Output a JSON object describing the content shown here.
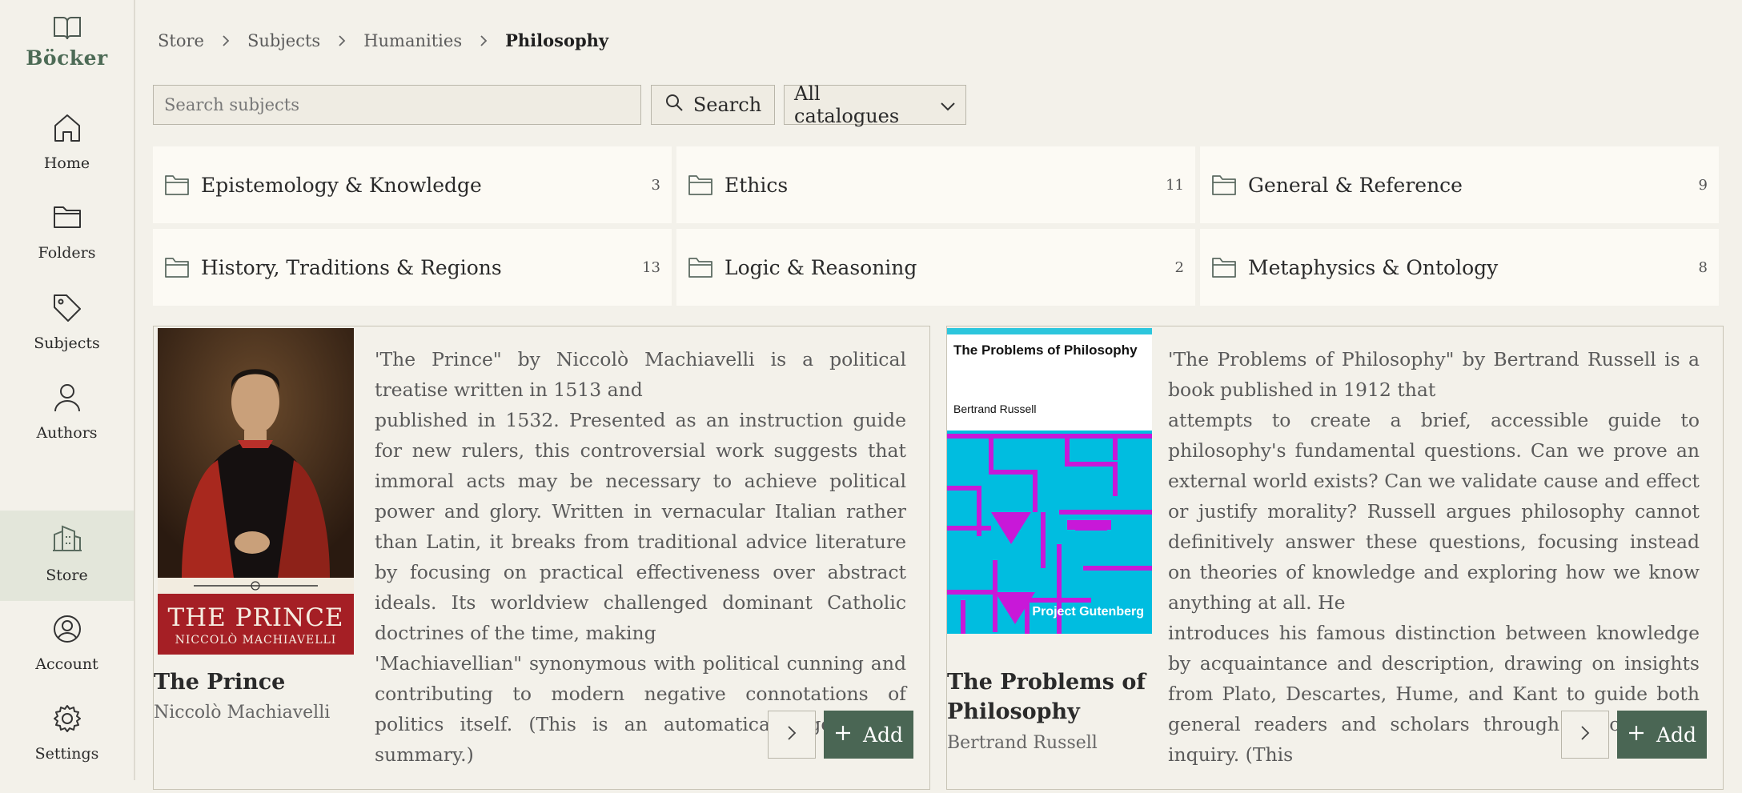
{
  "app": {
    "name": "Böcker"
  },
  "nav": {
    "home": "Home",
    "folders": "Folders",
    "subjects": "Subjects",
    "authors": "Authors",
    "store": "Store",
    "account": "Account",
    "settings": "Settings"
  },
  "breadcrumb": [
    "Store",
    "Subjects",
    "Humanities",
    "Philosophy"
  ],
  "search": {
    "placeholder": "Search subjects",
    "value": "",
    "button_label": "Search"
  },
  "catalog_select": {
    "selected": "All catalogues"
  },
  "categories": [
    {
      "name": "Epistemology & Knowledge",
      "count": "3"
    },
    {
      "name": "Ethics",
      "count": "11"
    },
    {
      "name": "General & Reference",
      "count": "9"
    },
    {
      "name": "History, Traditions & Regions",
      "count": "13"
    },
    {
      "name": "Logic & Reasoning",
      "count": "2"
    },
    {
      "name": "Metaphysics & Ontology",
      "count": "8"
    }
  ],
  "books": [
    {
      "title": "The Prince",
      "author": "Niccolò Machiavelli",
      "cover_title": "THE PRINCE",
      "cover_author": "NICCOLÒ MACHIAVELLI",
      "summary_lines": [
        "'The Prince\" by Niccolò Machiavelli is a political treatise written in 1513 and",
        "published in 1532. Presented as an instruction guide for new rulers, this controversial work suggests that immoral acts may be necessary to achieve political power and glory. Written in vernacular Italian rather than Latin, it breaks from traditional advice literature by focusing on practical effectiveness over abstract ideals. Its worldview challenged dominant Catholic doctrines of the time, making",
        "'Machiavellian\" synonymous with political cunning and contributing to modern negative connotations of politics itself. (This is an automatically generated summary.)"
      ],
      "add_label": "Add"
    },
    {
      "title": "The Problems of Philosophy",
      "author": "Bertrand Russell",
      "cover_title": "The Problems of Philosophy",
      "cover_author": "Bertrand Russell",
      "cover_publisher": "Project Gutenberg",
      "summary_lines": [
        "'The Problems of Philosophy\" by Bertrand Russell is a book published in 1912 that",
        "attempts to create a brief, accessible guide to philosophy's fundamental questions. Can we prove an external world exists? Can we validate cause and effect or justify morality? Russell argues philosophy cannot definitively answer these questions, focusing instead on theories of knowledge and exploring how we know anything at all. He",
        "introduces his famous distinction between knowledge by acquaintance and description, drawing on insights from Plato, Descartes, Hume, and Kant to guide both general readers and scholars through philosophical inquiry. (This"
      ],
      "add_label": "Add"
    }
  ],
  "colors": {
    "accent": "#4a6654",
    "brand": "#4d6b56",
    "background": "#f3f1ea",
    "tile": "#fcfaf4"
  }
}
